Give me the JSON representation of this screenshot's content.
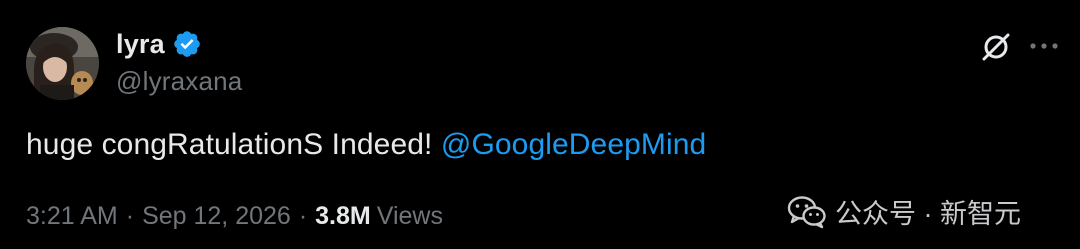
{
  "author": {
    "display_name": "lyra",
    "handle": "@lyraxana",
    "verified": true,
    "avatar_icon": "avatar-photo"
  },
  "tweet": {
    "text_plain": "huge congRatulationS Indeed! ",
    "mention": "@GoogleDeepMind"
  },
  "meta": {
    "time": "3:21 AM",
    "separator": "·",
    "date": "Sep 12, 2026",
    "views_count": "3.8M",
    "views_label": "Views"
  },
  "actions": {
    "grok_icon": "grok-icon",
    "more_icon": "more-icon"
  },
  "watermark": {
    "text": "公众号 · 新智元",
    "icon": "wechat-icon"
  },
  "colors": {
    "background": "#000000",
    "text_primary": "#e7e9ea",
    "text_secondary": "#71767b",
    "link": "#1d9bf0",
    "verified_badge": "#1d9bf0"
  }
}
